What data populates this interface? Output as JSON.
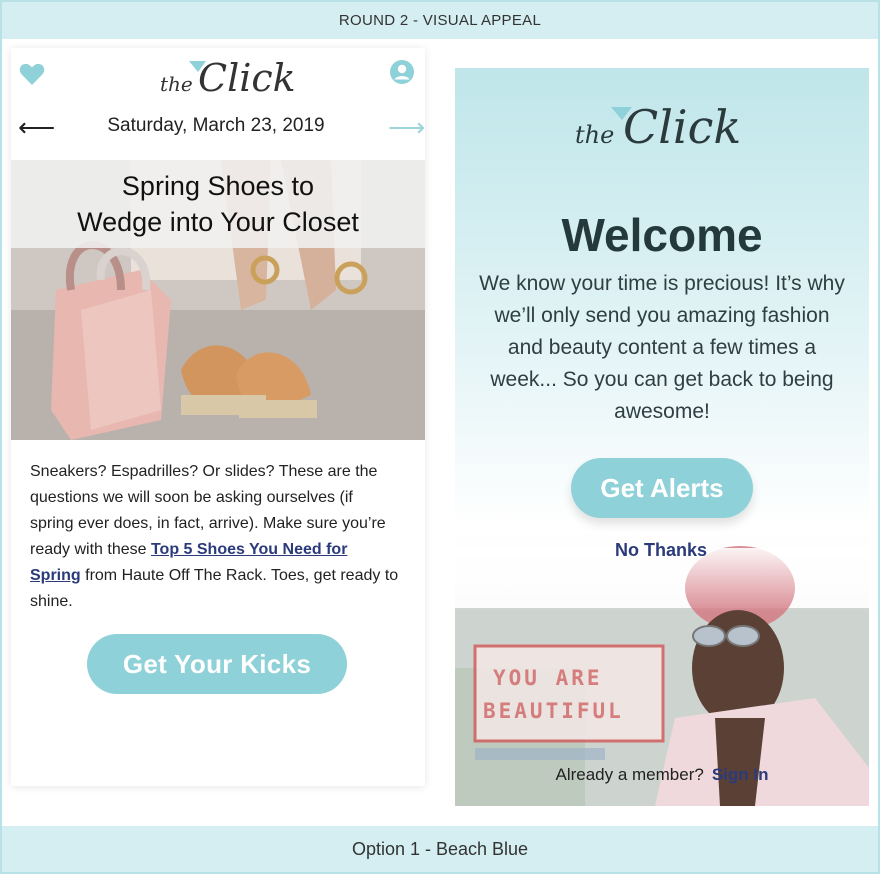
{
  "header": {
    "title": "ROUND 2 - VISUAL APPEAL"
  },
  "footer": {
    "label": "Option 1 - Beach Blue"
  },
  "app": {
    "logo_small": "the",
    "logo_big": "Click",
    "date": "Saturday, March 23, 2019",
    "article": {
      "title_line1": "Spring Shoes to",
      "title_line2": "Wedge into Your Closet",
      "body_before": "Sneakers? Espadrilles? Or slides? These are the questions we will soon be asking ourselves (if spring ever does, in fact, arrive). Make sure you’re ready with these ",
      "link_text": "Top 5 Shoes You Need for Spring",
      "body_after": " from Haute Off The Rack. Toes, get ready to shine.",
      "cta": "Get Your Kicks"
    }
  },
  "welcome": {
    "title": "Welcome",
    "body": "We know your time is precious! It’s why we’ll only send you amazing fashion and beauty content a few times a week... So you can get back to being awesome!",
    "cta": "Get Alerts",
    "secondary": "No Thanks",
    "member_text": "Already a member?",
    "signin": "Sign In",
    "sign_text": "YOU ARE BEAUTIFUL"
  },
  "colors": {
    "accent": "#8fd1d8",
    "link": "#2a3a7a",
    "bar": "#d4eef1"
  },
  "icons": [
    "heart-icon",
    "user-icon",
    "arrow-left-icon",
    "arrow-right-icon"
  ]
}
